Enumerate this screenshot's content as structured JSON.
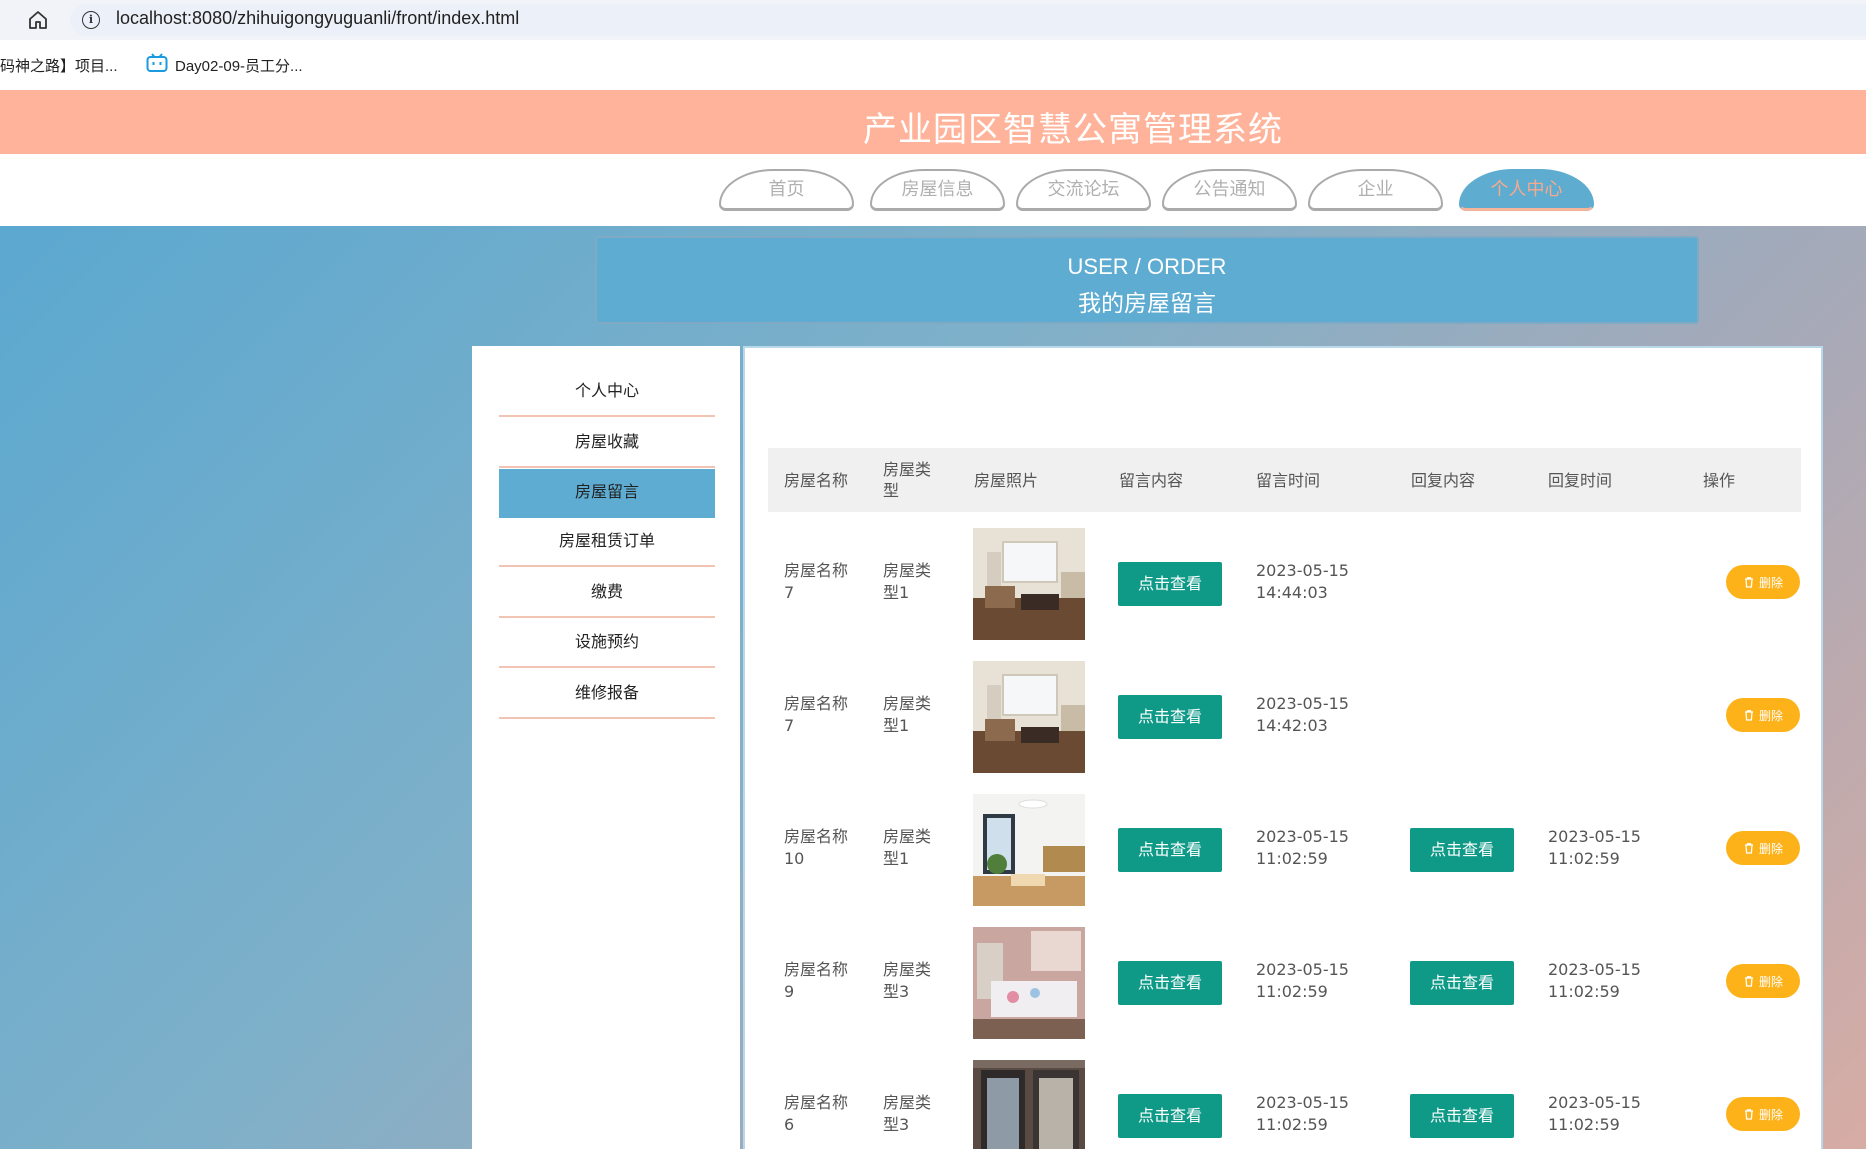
{
  "browser": {
    "url": "localhost:8080/zhihuigongyuguanli/front/index.html",
    "bookmarks": [
      "码神之路】项目...",
      "Day02-09-员工分..."
    ]
  },
  "site": {
    "title": "产业园区智慧公寓管理系统",
    "nav": [
      "首页",
      "房屋信息",
      "交流论坛",
      "公告通知",
      "企业",
      "个人中心"
    ],
    "active_nav": "个人中心"
  },
  "banner": {
    "en": "USER / ORDER",
    "cn": "我的房屋留言"
  },
  "sidebar": {
    "items": [
      "个人中心",
      "房屋收藏",
      "房屋留言",
      "房屋租赁订单",
      "缴费",
      "设施预约",
      "维修报备"
    ],
    "active": "房屋留言"
  },
  "table": {
    "columns": [
      "房屋名称",
      "房屋类型",
      "房屋照片",
      "留言内容",
      "留言时间",
      "回复内容",
      "回复时间",
      "操作"
    ],
    "view_label": "点击查看",
    "delete_label": "删除",
    "rows": [
      {
        "name_line1": "房屋名称",
        "name_line2": "7",
        "type_line1": "房屋类",
        "type_line2": "型1",
        "photo": "room-photo-1",
        "msg_time_date": "2023-05-15",
        "msg_time_clock": "14:44:03",
        "has_reply": false,
        "reply_time_date": "",
        "reply_time_clock": ""
      },
      {
        "name_line1": "房屋名称",
        "name_line2": "7",
        "type_line1": "房屋类",
        "type_line2": "型1",
        "photo": "room-photo-1",
        "msg_time_date": "2023-05-15",
        "msg_time_clock": "14:42:03",
        "has_reply": false,
        "reply_time_date": "",
        "reply_time_clock": ""
      },
      {
        "name_line1": "房屋名称",
        "name_line2": "10",
        "type_line1": "房屋类",
        "type_line2": "型1",
        "photo": "room-photo-2",
        "msg_time_date": "2023-05-15",
        "msg_time_clock": "11:02:59",
        "has_reply": true,
        "reply_time_date": "2023-05-15",
        "reply_time_clock": "11:02:59"
      },
      {
        "name_line1": "房屋名称",
        "name_line2": "9",
        "type_line1": "房屋类",
        "type_line2": "型3",
        "photo": "room-photo-3",
        "msg_time_date": "2023-05-15",
        "msg_time_clock": "11:02:59",
        "has_reply": true,
        "reply_time_date": "2023-05-15",
        "reply_time_clock": "11:02:59"
      },
      {
        "name_line1": "房屋名称",
        "name_line2": "6",
        "type_line1": "房屋类",
        "type_line2": "型3",
        "photo": "room-photo-4",
        "msg_time_date": "2023-05-15",
        "msg_time_clock": "11:02:59",
        "has_reply": true,
        "reply_time_date": "2023-05-15",
        "reply_time_clock": "11:02:59"
      }
    ]
  },
  "colors": {
    "header": "#ffb39a",
    "accent": "#5eacd1",
    "view_button": "#0f9a88",
    "delete_button": "#fdb21a"
  }
}
